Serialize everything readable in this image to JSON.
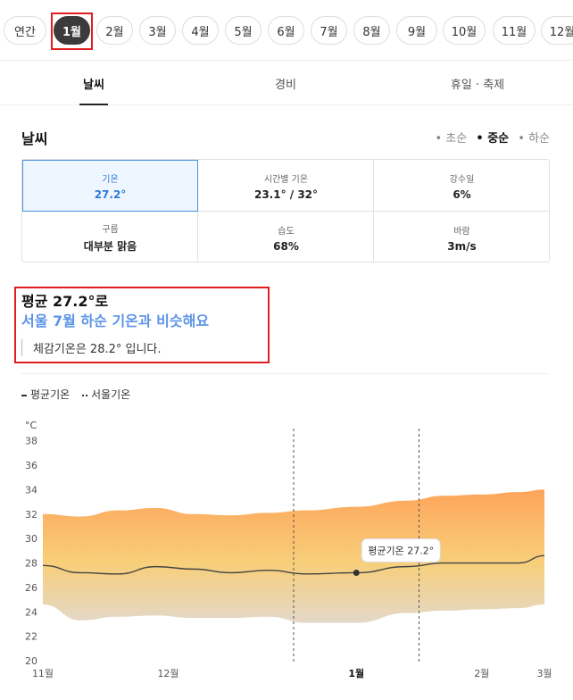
{
  "months": {
    "items": [
      "연간",
      "1월",
      "2월",
      "3월",
      "4월",
      "5월",
      "6월",
      "7월",
      "8월",
      "9월",
      "10월",
      "11월",
      "12월"
    ],
    "selected": "1월"
  },
  "tabs": {
    "weather": "날씨",
    "cost": "경비",
    "holiday": "휴일 · 축제"
  },
  "weather": {
    "title": "날씨",
    "period_filter": [
      "• 초순",
      "• 중순",
      "• 하순"
    ],
    "period_selected": "• 중순",
    "stats": {
      "temp": {
        "label": "기온",
        "value": "27.2°"
      },
      "hourly": {
        "label": "시간별 기온",
        "value": "23.1° / 32°"
      },
      "rain": {
        "label": "강수일",
        "value": "6%"
      },
      "cloud": {
        "label": "구름",
        "value": "대부분 맑음"
      },
      "humidity": {
        "label": "습도",
        "value": "68%"
      },
      "wind": {
        "label": "바람",
        "value": "3m/s"
      }
    }
  },
  "summary": {
    "line1": "평균 27.2°로",
    "line2": "서울 7월 하순 기온과 비슷해요",
    "line3": "체감기온은 28.2° 입니다."
  },
  "legend": {
    "avg": "평균기온",
    "seoul": "서울기온"
  },
  "chart_data": {
    "type": "area",
    "ylabel": "°C",
    "ylim": [
      20,
      39
    ],
    "yticks": [
      20,
      22,
      24,
      26,
      28,
      30,
      32,
      34,
      36,
      38
    ],
    "x_labels": [
      "11월",
      "12월",
      "1월",
      "2월",
      "3월"
    ],
    "x_label_positions": [
      0,
      1,
      2.5,
      3.5,
      4
    ],
    "x_span": [
      0,
      4
    ],
    "highlight_range": [
      2,
      3
    ],
    "tooltip": "평균기온 27.2°",
    "marker": {
      "x": 2.5,
      "y": 27.2
    },
    "series": [
      {
        "name": "평균기온",
        "x": [
          0,
          0.3,
          0.6,
          0.9,
          1.2,
          1.5,
          1.8,
          2.1,
          2.5,
          2.9,
          3.2,
          3.5,
          3.8,
          4.0
        ],
        "avg": [
          27.8,
          27.2,
          27.1,
          27.7,
          27.5,
          27.2,
          27.4,
          27.1,
          27.2,
          27.7,
          28.0,
          28.0,
          28.0,
          28.6
        ],
        "max": [
          32.0,
          31.8,
          32.3,
          32.5,
          32.0,
          31.9,
          32.1,
          32.3,
          32.6,
          33.1,
          33.5,
          33.6,
          33.8,
          34.0
        ],
        "min": [
          24.6,
          23.3,
          23.6,
          23.7,
          23.5,
          23.5,
          23.6,
          23.1,
          23.1,
          23.9,
          24.1,
          24.2,
          24.3,
          24.6
        ]
      }
    ]
  }
}
